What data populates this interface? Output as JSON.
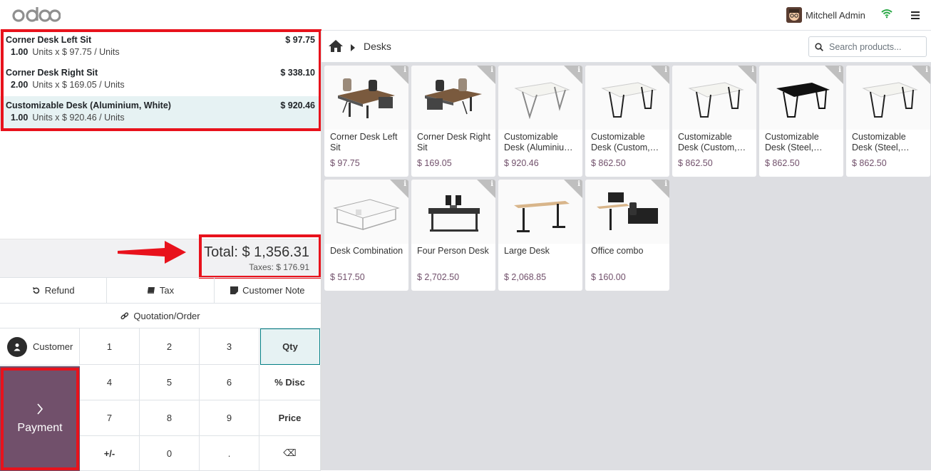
{
  "header": {
    "logo_text": "odoo",
    "user_name": "Mitchell Admin",
    "wifi_icon": "wifi-icon",
    "menu_icon": "hamburger-icon"
  },
  "order": {
    "lines": [
      {
        "name": "Corner Desk Left Sit",
        "price": "$ 97.75",
        "qty": "1.00",
        "detail": "Units x $ 97.75 / Units",
        "selected": false
      },
      {
        "name": "Corner Desk Right Sit",
        "price": "$ 338.10",
        "qty": "2.00",
        "detail": "Units x $ 169.05 / Units",
        "selected": false
      },
      {
        "name": "Customizable Desk (Aluminium, White)",
        "price": "$ 920.46",
        "qty": "1.00",
        "detail": "Units x $ 920.46 / Units",
        "selected": true
      }
    ],
    "total": "Total: $ 1,356.31",
    "taxes": "Taxes: $ 176.91"
  },
  "controls": {
    "refund": "Refund",
    "tax": "Tax",
    "customer_note": "Customer Note",
    "quotation": "Quotation/Order"
  },
  "keypad": {
    "customer": "Customer",
    "payment": "Payment",
    "keys": [
      "1",
      "2",
      "3",
      "Qty",
      "4",
      "5",
      "6",
      "% Disc",
      "7",
      "8",
      "9",
      "Price",
      "+/-",
      "0",
      ".",
      "⌫"
    ]
  },
  "products": {
    "breadcrumb": "Desks",
    "search_placeholder": "Search products...",
    "items": [
      {
        "name": "Corner Desk Left Sit",
        "price": "$ 97.75"
      },
      {
        "name": "Corner Desk Right Sit",
        "price": "$ 169.05"
      },
      {
        "name": "Customizable Desk (Aluminiu…",
        "price": "$ 920.46"
      },
      {
        "name": "Customizable Desk (Custom,…",
        "price": "$ 862.50"
      },
      {
        "name": "Customizable Desk (Custom,…",
        "price": "$ 862.50"
      },
      {
        "name": "Customizable Desk (Steel,…",
        "price": "$ 862.50"
      },
      {
        "name": "Customizable Desk (Steel,…",
        "price": "$ 862.50"
      },
      {
        "name": "Desk Combination",
        "price": "$ 517.50"
      },
      {
        "name": "Four Person Desk",
        "price": "$ 2,702.50"
      },
      {
        "name": "Large Desk",
        "price": "$ 2,068.85"
      },
      {
        "name": "Office combo",
        "price": "$ 160.00"
      }
    ]
  },
  "colors": {
    "brand": "#71506b",
    "highlight": "#e8121c",
    "selected_line": "#e6f2f3"
  }
}
